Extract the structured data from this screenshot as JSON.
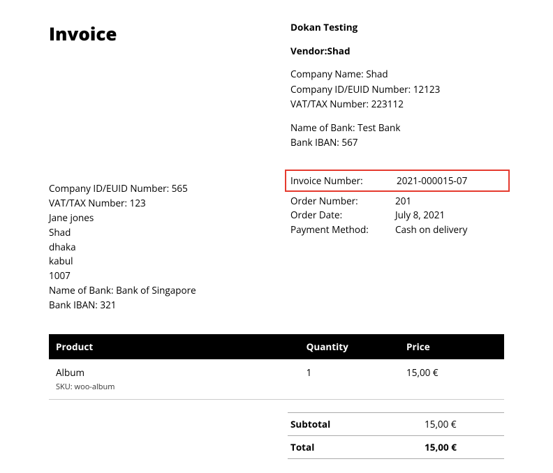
{
  "title": "Invoice",
  "vendor": {
    "store_name": "Dokan Testing",
    "vendor_line": "Vendor:Shad",
    "company_name": "Company Name: Shad",
    "company_id": "Company ID/EUID Number: 12123",
    "vat": "VAT/TAX Number: 223112",
    "bank_name": "Name of Bank: Test Bank",
    "bank_iban": "Bank IBAN: 567"
  },
  "buyer": {
    "company_id": "Company ID/EUID Number: 565",
    "vat": "VAT/TAX Number: 123",
    "name": "Jane jones",
    "line1": "Shad",
    "line2": "dhaka",
    "line3": "kabul",
    "postal": "1007",
    "bank_name": "Name of Bank: Bank of Singapore",
    "bank_iban": "Bank IBAN: 321"
  },
  "meta": {
    "invoice_number_label": "Invoice Number:",
    "invoice_number": "2021-000015-07",
    "order_number_label": "Order Number:",
    "order_number": "201",
    "order_date_label": "Order Date:",
    "order_date": "July 8, 2021",
    "payment_method_label": "Payment Method:",
    "payment_method": "Cash on delivery"
  },
  "table": {
    "headers": {
      "product": "Product",
      "qty": "Quantity",
      "price": "Price"
    },
    "row": {
      "product": "Album",
      "sku_label": "SKU:",
      "sku": "woo-album",
      "qty": "1",
      "price": "15,00 €"
    }
  },
  "totals": {
    "subtotal_label": "Subtotal",
    "subtotal": "15,00 €",
    "total_label": "Total",
    "total": "15,00 €"
  }
}
